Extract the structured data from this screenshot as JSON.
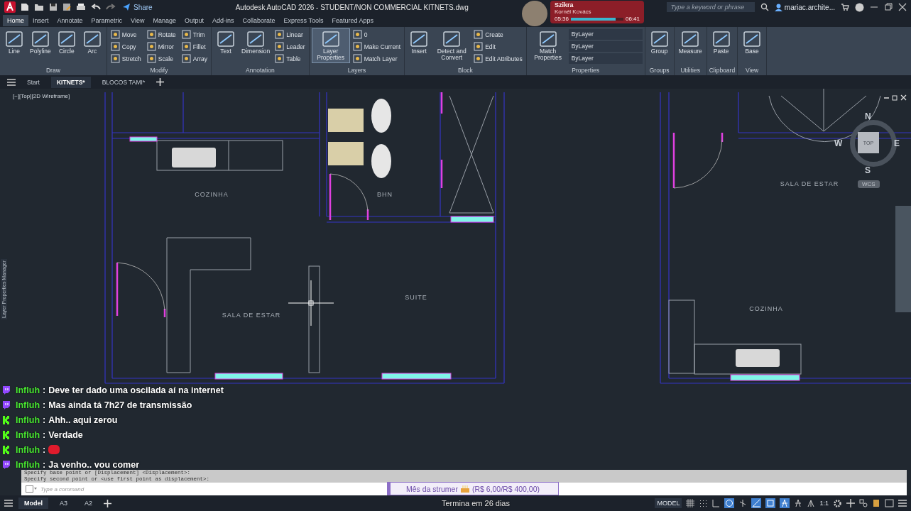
{
  "app": {
    "title": "Autodesk AutoCAD 2026 - STUDENT/NON COMMERCIAL    KITNETS.dwg",
    "share": "Share",
    "search_placeholder": "Type a keyword or phrase",
    "user": "mariac.archite..."
  },
  "music": {
    "track": "Szikra",
    "artist": "Kornél Kovács",
    "elapsed": "05:36",
    "total": "06:41",
    "level": 0.85
  },
  "ribbon_tabs": [
    {
      "label": "Home",
      "selected": true
    },
    {
      "label": "Insert",
      "selected": false
    },
    {
      "label": "Annotate",
      "selected": false
    },
    {
      "label": "Parametric",
      "selected": false
    },
    {
      "label": "View",
      "selected": false
    },
    {
      "label": "Manage",
      "selected": false
    },
    {
      "label": "Output",
      "selected": false
    },
    {
      "label": "Add-ins",
      "selected": false
    },
    {
      "label": "Collaborate",
      "selected": false
    },
    {
      "label": "Express Tools",
      "selected": false
    },
    {
      "label": "Featured Apps",
      "selected": false
    }
  ],
  "ribbon_panels": [
    {
      "title": "Draw",
      "tools": [
        {
          "kind": "large",
          "label": "Line",
          "selected": false
        },
        {
          "kind": "large",
          "label": "Polyline",
          "selected": false
        },
        {
          "kind": "large",
          "label": "Circle",
          "selected": false
        },
        {
          "kind": "large",
          "label": "Arc",
          "selected": false
        }
      ]
    },
    {
      "title": "Modify",
      "tools": [
        {
          "kind": "small",
          "label": "Move",
          "selected": false
        },
        {
          "kind": "small",
          "label": "Copy",
          "selected": false
        },
        {
          "kind": "small",
          "label": "Stretch",
          "selected": false
        },
        {
          "kind": "small",
          "label": "Rotate",
          "selected": false
        },
        {
          "kind": "small",
          "label": "Mirror",
          "selected": false
        },
        {
          "kind": "small",
          "label": "Scale",
          "selected": false
        },
        {
          "kind": "small",
          "label": "Trim",
          "selected": false
        },
        {
          "kind": "small",
          "label": "Fillet",
          "selected": false
        },
        {
          "kind": "small",
          "label": "Array",
          "selected": false
        }
      ]
    },
    {
      "title": "Annotation",
      "tools": [
        {
          "kind": "large",
          "label": "Text",
          "selected": false
        },
        {
          "kind": "large",
          "label": "Dimension",
          "selected": false
        },
        {
          "kind": "small",
          "label": "Linear",
          "selected": false
        },
        {
          "kind": "small",
          "label": "Leader",
          "selected": false
        },
        {
          "kind": "small",
          "label": "Table",
          "selected": false
        }
      ]
    },
    {
      "title": "Layers",
      "tools": [
        {
          "kind": "large",
          "label": "Layer Properties",
          "selected": true
        },
        {
          "kind": "small",
          "label": "0",
          "selected": false
        },
        {
          "kind": "small",
          "label": "Make Current",
          "selected": false
        },
        {
          "kind": "small",
          "label": "Match Layer",
          "selected": false
        }
      ]
    },
    {
      "title": "Block",
      "tools": [
        {
          "kind": "large",
          "label": "Insert",
          "selected": false
        },
        {
          "kind": "large",
          "label": "Detect and Convert",
          "selected": false
        },
        {
          "kind": "small",
          "label": "Create",
          "selected": false
        },
        {
          "kind": "small",
          "label": "Edit",
          "selected": false
        },
        {
          "kind": "small",
          "label": "Edit Attributes",
          "selected": false
        }
      ]
    },
    {
      "title": "Properties",
      "tools": [
        {
          "kind": "large",
          "label": "Match Properties",
          "selected": false
        },
        {
          "kind": "dropdown",
          "label": "ByLayer",
          "selected": false
        },
        {
          "kind": "dropdown",
          "label": "ByLayer",
          "selected": false
        },
        {
          "kind": "dropdown",
          "label": "ByLayer",
          "selected": false
        }
      ]
    },
    {
      "title": "Groups",
      "tools": [
        {
          "kind": "large",
          "label": "Group",
          "selected": false
        }
      ]
    },
    {
      "title": "Utilities",
      "tools": [
        {
          "kind": "large",
          "label": "Measure",
          "selected": false
        }
      ]
    },
    {
      "title": "Clipboard",
      "tools": [
        {
          "kind": "large",
          "label": "Paste",
          "selected": false
        }
      ]
    },
    {
      "title": "View",
      "tools": [
        {
          "kind": "large",
          "label": "Base",
          "selected": false
        }
      ]
    }
  ],
  "doc_tabs": [
    {
      "label": "Start",
      "selected": false
    },
    {
      "label": "KITNETS*",
      "selected": true
    },
    {
      "label": "BLOCOS TAMI*",
      "selected": false
    }
  ],
  "viewport": {
    "label": "[−][Top][2D Wireframe]",
    "side_panel": "Layer Properties Manager",
    "rooms": [
      "COZINHA",
      "BHN",
      "SALA DE ESTAR",
      "SUITE",
      "SALA DE ESTAR",
      "COZINHA"
    ],
    "viewcube": {
      "north": "N",
      "east": "E",
      "south": "S",
      "west": "W",
      "face": "TOP",
      "ucs": "WCS"
    }
  },
  "chat": [
    {
      "kind": "twitch",
      "user": "Influh",
      "separator": ":",
      "text": "Deve ter dado uma oscilada aí na internet",
      "emote": false
    },
    {
      "kind": "twitch",
      "user": "Influh",
      "separator": ":",
      "text": "Mas ainda tá 7h27 de transmissão",
      "emote": false
    },
    {
      "kind": "kick",
      "user": "Influh",
      "separator": ":",
      "text": "Ahh.. aqui zerou",
      "emote": false
    },
    {
      "kind": "kick",
      "user": "Influh",
      "separator": ":",
      "text": "Verdade",
      "emote": false
    },
    {
      "kind": "kick",
      "user": "Influh",
      "separator": ":",
      "emote": true
    },
    {
      "kind": "twitch",
      "user": "Influh",
      "separator": ":",
      "text": "Ja venho.. vou comer",
      "emote": false
    }
  ],
  "command_line": {
    "history": [
      "Specify base point or [Displacement] <Displacement>:",
      "Specify second point or <use first point as displacement>:"
    ],
    "placeholder": "Type a command"
  },
  "goal": {
    "title": "Mês da strumer",
    "amount": "(R$ 6,00/R$ 400,00)",
    "level": 0.015,
    "ends": "Termina em 26 dias"
  },
  "layout_tabs": [
    {
      "label": "Model",
      "selected": true
    },
    {
      "label": "A3",
      "selected": false
    },
    {
      "label": "A2",
      "selected": false
    }
  ],
  "status_bar": {
    "space": "MODEL",
    "scale": "1:1"
  }
}
